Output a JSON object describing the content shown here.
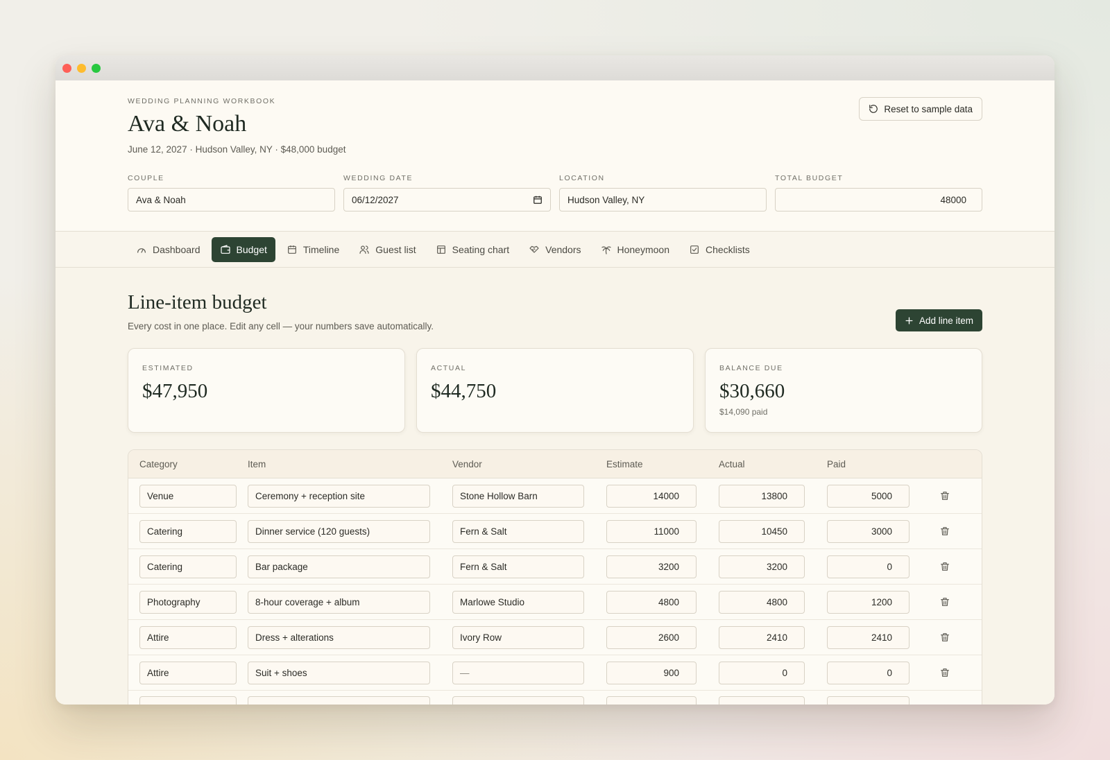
{
  "header": {
    "eyebrow": "WEDDING PLANNING WORKBOOK",
    "title": "Ava & Noah",
    "subline": "June 12, 2027 · Hudson Valley, NY · $48,000 budget",
    "reset_label": "Reset to sample data"
  },
  "fields": {
    "couple": {
      "label": "COUPLE",
      "value": "Ava & Noah"
    },
    "date": {
      "label": "WEDDING DATE",
      "value": "06/12/2027"
    },
    "location": {
      "label": "LOCATION",
      "value": "Hudson Valley, NY"
    },
    "budget": {
      "label": "TOTAL BUDGET",
      "value": "48000"
    }
  },
  "tabs": [
    {
      "label": "Dashboard",
      "icon": "gauge-icon"
    },
    {
      "label": "Budget",
      "icon": "wallet-icon",
      "active": true
    },
    {
      "label": "Timeline",
      "icon": "calendar-icon"
    },
    {
      "label": "Guest list",
      "icon": "users-icon"
    },
    {
      "label": "Seating chart",
      "icon": "layout-icon"
    },
    {
      "label": "Vendors",
      "icon": "handshake-icon"
    },
    {
      "label": "Honeymoon",
      "icon": "palm-tree-icon"
    },
    {
      "label": "Checklists",
      "icon": "checkbox-icon"
    }
  ],
  "section": {
    "title": "Line-item budget",
    "subtitle": "Every cost in one place. Edit any cell — your numbers save automatically.",
    "add_label": "Add line item"
  },
  "stats": {
    "estimated": {
      "label": "ESTIMATED",
      "value": "$47,950"
    },
    "actual": {
      "label": "ACTUAL",
      "value": "$44,750"
    },
    "balance": {
      "label": "BALANCE DUE",
      "value": "$30,660",
      "note": "$14,090 paid"
    }
  },
  "table": {
    "columns": {
      "category": "Category",
      "item": "Item",
      "vendor": "Vendor",
      "estimate": "Estimate",
      "actual": "Actual",
      "paid": "Paid"
    },
    "rows": [
      {
        "category": "Venue",
        "item": "Ceremony + reception site",
        "vendor": "Stone Hollow Barn",
        "estimate": "14000",
        "actual": "13800",
        "paid": "5000"
      },
      {
        "category": "Catering",
        "item": "Dinner service (120 guests)",
        "vendor": "Fern & Salt",
        "estimate": "11000",
        "actual": "10450",
        "paid": "3000"
      },
      {
        "category": "Catering",
        "item": "Bar package",
        "vendor": "Fern & Salt",
        "estimate": "3200",
        "actual": "3200",
        "paid": "0"
      },
      {
        "category": "Photography",
        "item": "8-hour coverage + album",
        "vendor": "Marlowe Studio",
        "estimate": "4800",
        "actual": "4800",
        "paid": "1200"
      },
      {
        "category": "Attire",
        "item": "Dress + alterations",
        "vendor": "Ivory Row",
        "estimate": "2600",
        "actual": "2410",
        "paid": "2410"
      },
      {
        "category": "Attire",
        "item": "Suit + shoes",
        "vendor": "—",
        "estimate": "900",
        "actual": "0",
        "paid": "0"
      }
    ]
  }
}
